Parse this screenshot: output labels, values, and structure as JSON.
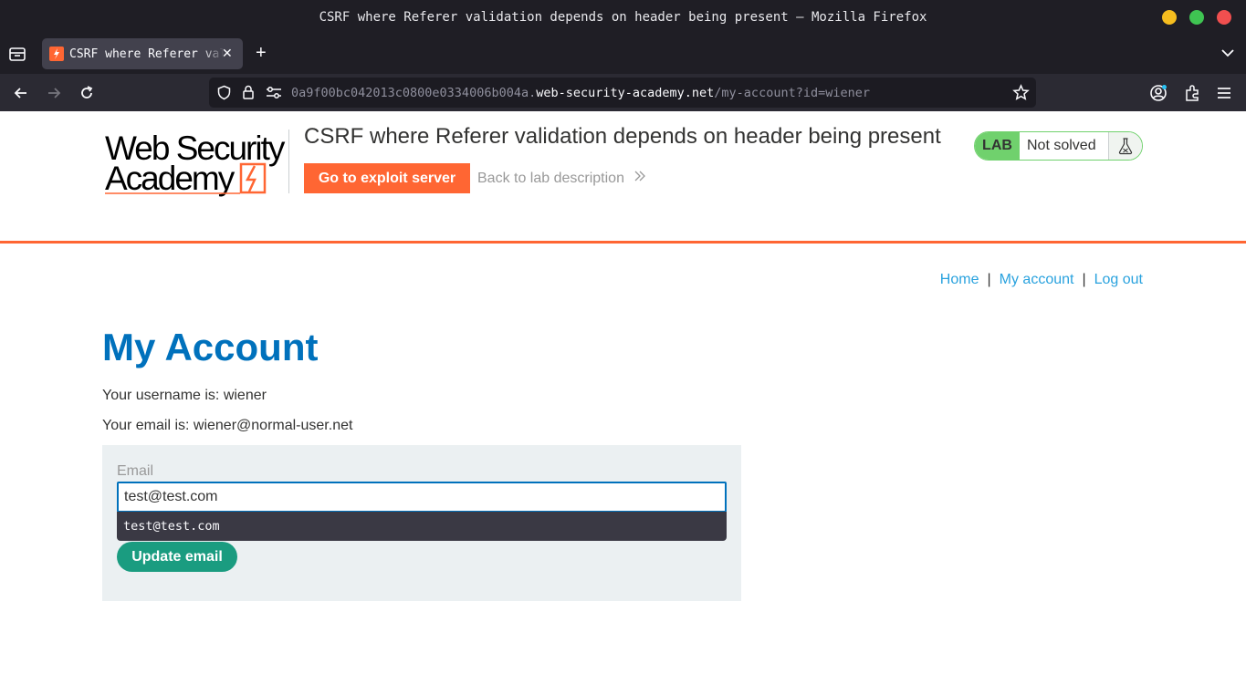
{
  "window": {
    "title": "CSRF where Referer validation depends on header being present — Mozilla Firefox"
  },
  "tabs": [
    {
      "title": "CSRF where Referer validation depends on header being present",
      "active": true
    }
  ],
  "urlbar": {
    "prefix": "0a9f00bc042013c0800e0334006b004a.",
    "host": "web-security-academy.net",
    "path": "/my-account?id=wiener"
  },
  "header": {
    "logo_text": "Web Security Academy",
    "lab_title": "CSRF where Referer validation depends on header being present",
    "exploit_button": "Go to exploit server",
    "back_link": "Back to lab description",
    "lab_badge": "LAB",
    "lab_status": "Not solved"
  },
  "nav": {
    "home": "Home",
    "account": "My account",
    "logout": "Log out",
    "separator": "|"
  },
  "account": {
    "heading": "My Account",
    "username_text": "Your username is: wiener",
    "email_text": "Your email is: wiener@normal-user.net"
  },
  "form": {
    "email_label": "Email",
    "email_value": "test@test.com",
    "autocomplete_suggestion": "test@test.com",
    "submit_label": "Update email"
  },
  "colors": {
    "brand_orange": "#ff6633",
    "heading_blue": "#0071bc",
    "link_blue": "#29a2de",
    "button_green": "#1a9c80",
    "lab_green": "#70d16d"
  }
}
